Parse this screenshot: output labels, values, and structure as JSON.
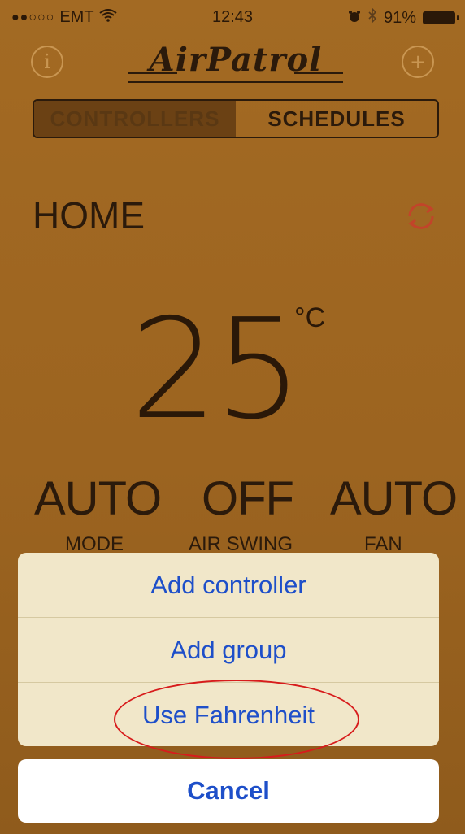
{
  "status_bar": {
    "carrier": "EMT",
    "time": "12:43",
    "battery": "91%"
  },
  "header": {
    "logo_text": "AirPatrol",
    "info_icon": "info-circle-icon",
    "add_icon": "plus-circle-icon"
  },
  "tabs": {
    "controllers": "CONTROLLERS",
    "schedules": "SCHEDULES"
  },
  "main": {
    "location": "HOME",
    "refresh_icon": "refresh-icon",
    "temperature": "25",
    "unit": "°C",
    "mode_value": "AUTO",
    "mode_label": "MODE",
    "swing_value": "OFF",
    "swing_label": "AIR SWING",
    "fan_value": "AUTO",
    "fan_label": "FAN"
  },
  "action_sheet": {
    "items": [
      "Add controller",
      "Add group",
      "Use Fahrenheit"
    ],
    "cancel": "Cancel"
  },
  "colors": {
    "background": "#9c6420",
    "accent_blue": "#1e4fc9",
    "highlight": "#d71c1c"
  }
}
